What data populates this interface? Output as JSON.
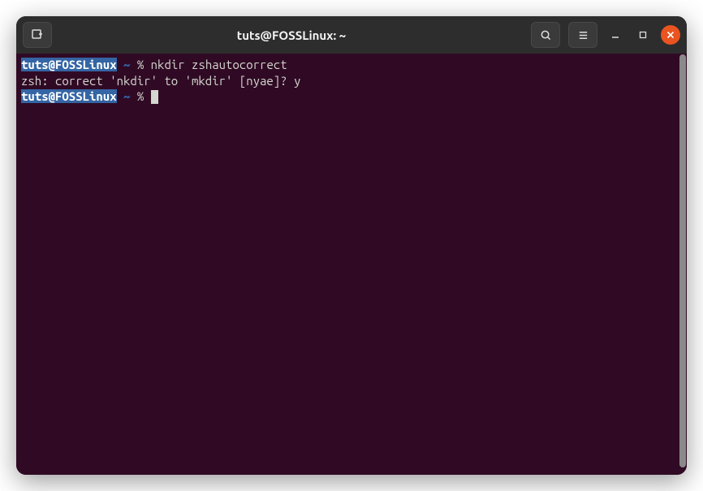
{
  "titlebar": {
    "title": "tuts@FOSSLinux: ~"
  },
  "terminal": {
    "prompt_user_host": "tuts@FOSSLinux",
    "prompt_path": "~",
    "prompt_symbol": "%",
    "line1_command": "nkdir zshautocorrect",
    "line2_output": "zsh: correct 'nkdir' to 'mkdir' [nyae]? y"
  }
}
